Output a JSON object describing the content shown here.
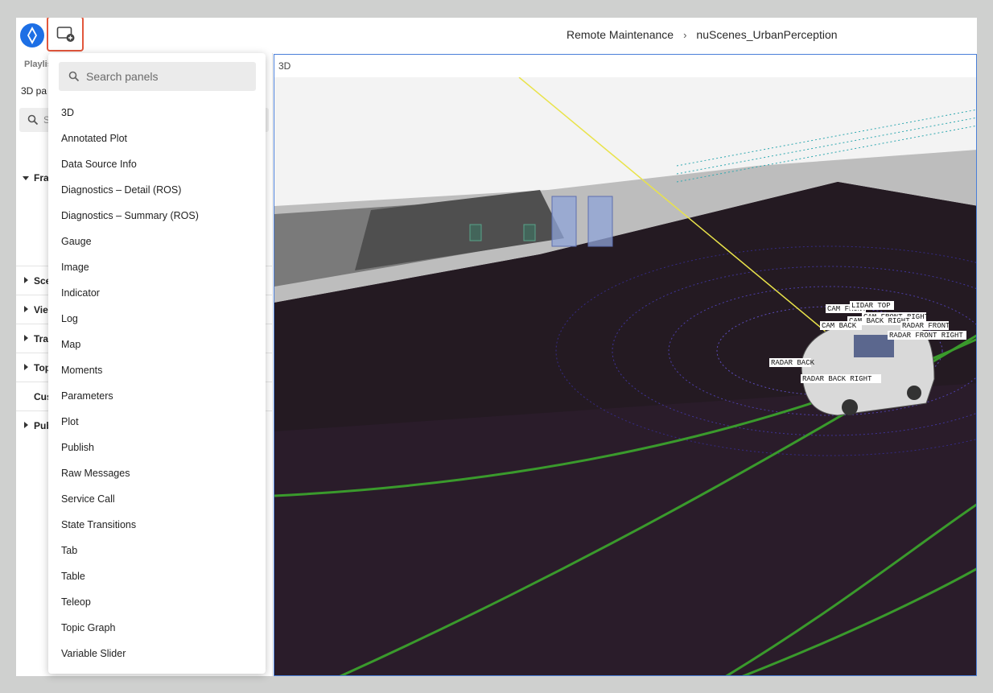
{
  "breadcrumb": {
    "org": "Remote Maintenance",
    "separator": "›",
    "dataset": "nuScenes_UrbanPerception"
  },
  "sidebar": {
    "tab": "Playlis",
    "panel_title": "3D pa",
    "search_placeholder": "S",
    "frame_section": "Fra",
    "sections": [
      "Sce",
      "Vie",
      "Tra",
      "Top",
      "Cus",
      "Pub"
    ]
  },
  "panel": {
    "title": "3D"
  },
  "panel_search": {
    "placeholder": "Search panels",
    "value": ""
  },
  "panel_list": [
    "3D",
    "Annotated Plot",
    "Data Source Info",
    "Diagnostics – Detail (ROS)",
    "Diagnostics – Summary (ROS)",
    "Gauge",
    "Image",
    "Indicator",
    "Log",
    "Map",
    "Moments",
    "Parameters",
    "Plot",
    "Publish",
    "Raw Messages",
    "Service Call",
    "State Transitions",
    "Tab",
    "Table",
    "Teleop",
    "Topic Graph",
    "Variable Slider"
  ],
  "scene_labels": [
    "CAM FRONT",
    "LIDAR TOP",
    "CAM FRONT RIGHT",
    "CAM BACK RIGHT",
    "CAM BACK",
    "RADAR FRONT",
    "RADAR FRONT RIGHT",
    "RADAR BACK",
    "RADAR BACK RIGHT"
  ],
  "colors": {
    "accent": "#e2573c",
    "brand": "#1d6fe5",
    "lane": "#3a9a2c",
    "ground": "#2a1c2a"
  }
}
